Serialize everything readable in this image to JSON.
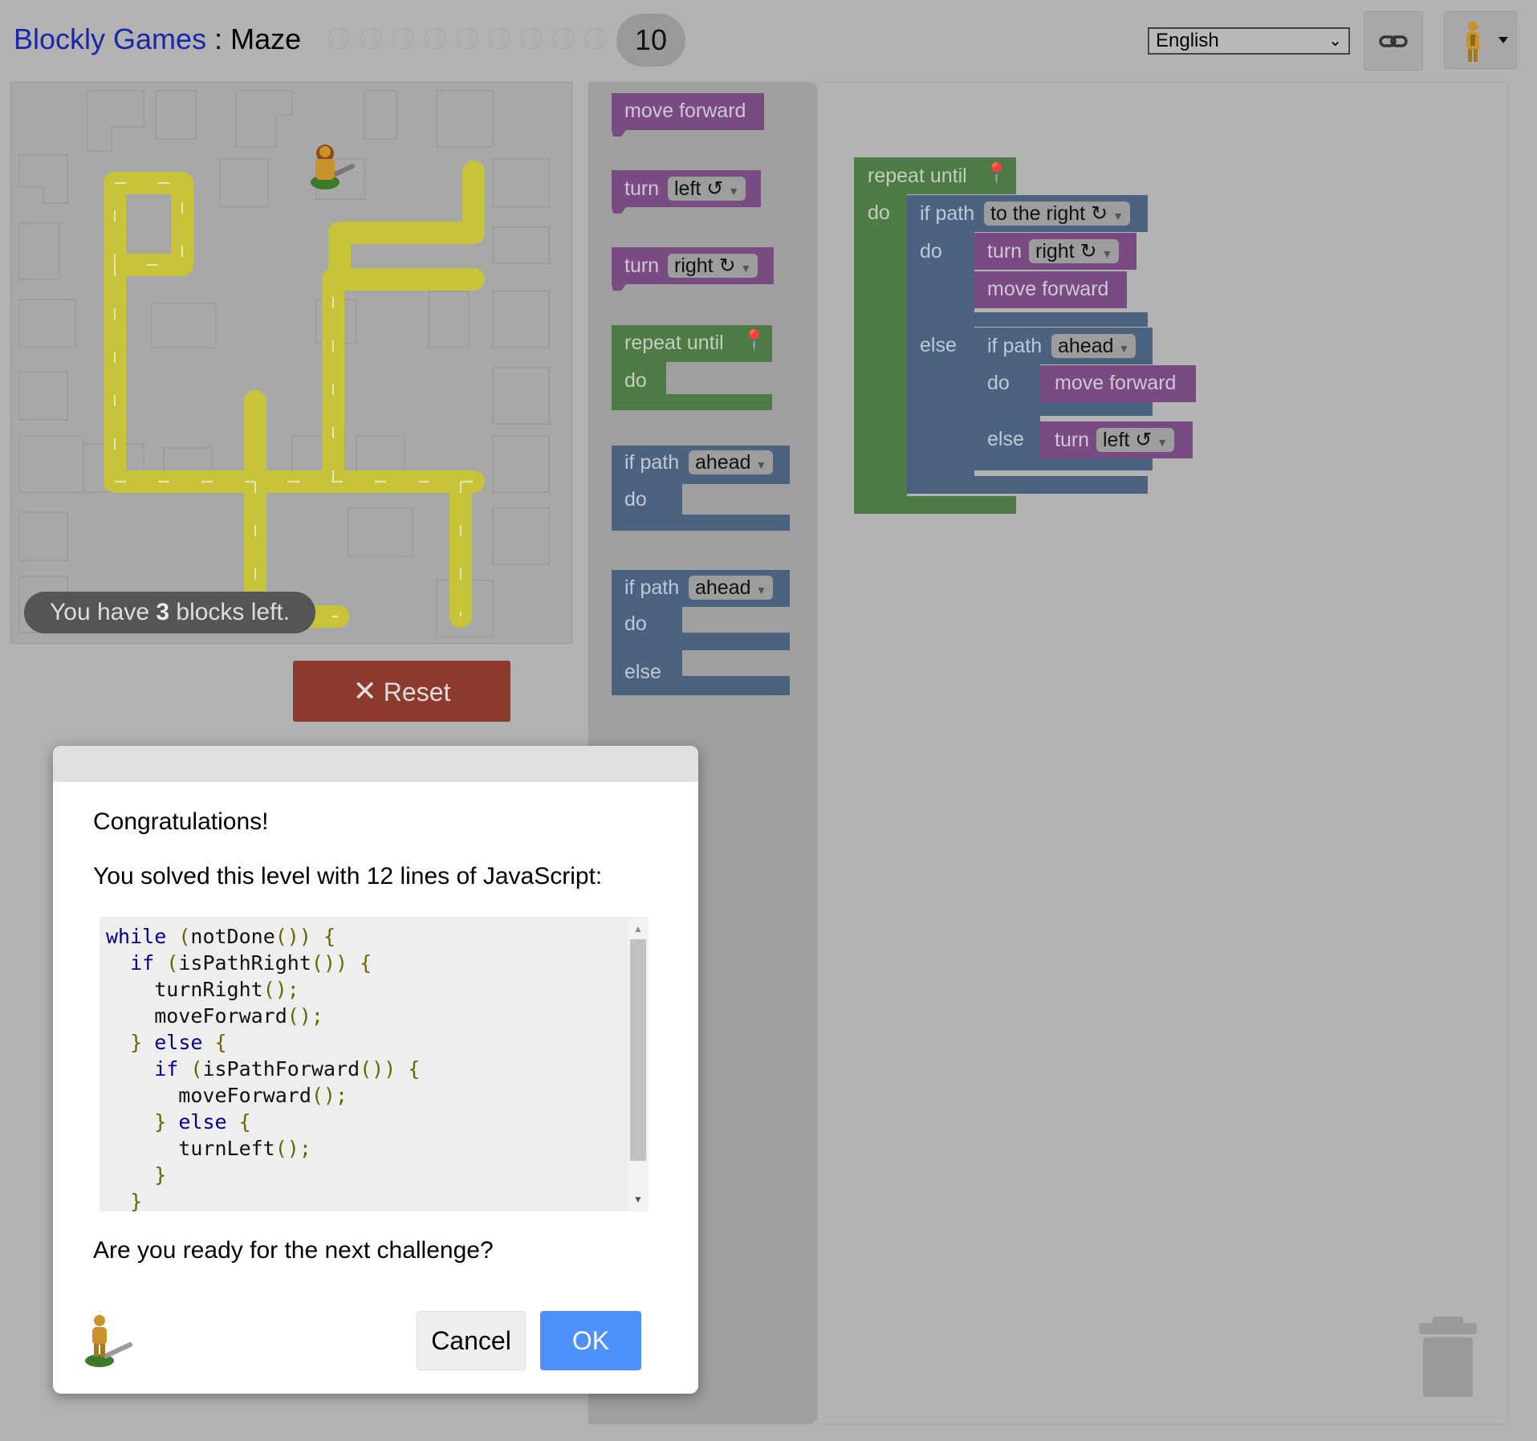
{
  "header": {
    "brand": "Blockly Games",
    "separator": " : ",
    "game": "Maze",
    "current_level": "10",
    "language": "English"
  },
  "maze": {
    "blocks_left_prefix": "You have ",
    "blocks_left_count": "3",
    "blocks_left_suffix": " blocks left."
  },
  "reset_label": "Reset",
  "toolbox": {
    "move_forward": "move forward",
    "turn": "turn",
    "left_opt": "left ↺",
    "right_opt": "right ↻",
    "repeat_until": "repeat until",
    "do": "do",
    "if_path": "if path",
    "ahead_opt": "ahead",
    "else": "else"
  },
  "program": {
    "repeat_until": "repeat until",
    "do": "do",
    "if_path": "if path",
    "to_the_right_opt": "to the right ↻",
    "turn": "turn",
    "right_opt": "right ↻",
    "move_forward": "move forward",
    "else": "else",
    "ahead_opt": "ahead",
    "left_opt": "left ↺"
  },
  "dialog": {
    "heading": "Congratulations!",
    "summary": "You solved this level with 12 lines of JavaScript:",
    "question": "Are you ready for the next challenge?",
    "cancel": "Cancel",
    "ok": "OK"
  },
  "colors": {
    "accent": "#4d90fe",
    "brand": "#1a28a5",
    "reset": "#8c3a2e",
    "motion_block": "#7a4b82",
    "loop_block": "#4e7a45",
    "logic_block": "#4b6281",
    "path": "#c8c43a"
  }
}
